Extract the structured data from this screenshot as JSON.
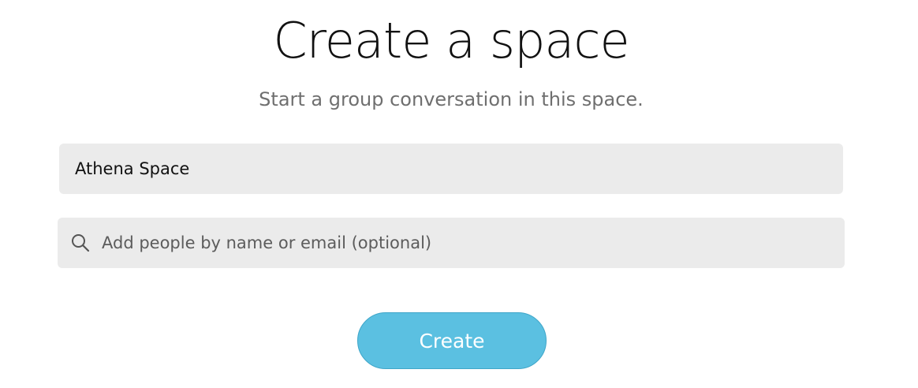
{
  "page": {
    "title": "Create a space",
    "subtitle": "Start a group conversation in this space."
  },
  "form": {
    "space_name": {
      "value": "Athena Space"
    },
    "people": {
      "placeholder": "Add people by name or email (optional)",
      "icon": "search-icon"
    },
    "create_label": "Create"
  },
  "colors": {
    "field_background": "#ebebeb",
    "button_background": "#5bc0e1",
    "button_border": "#3fa6c9",
    "subtitle_text": "#6f6f6f"
  }
}
